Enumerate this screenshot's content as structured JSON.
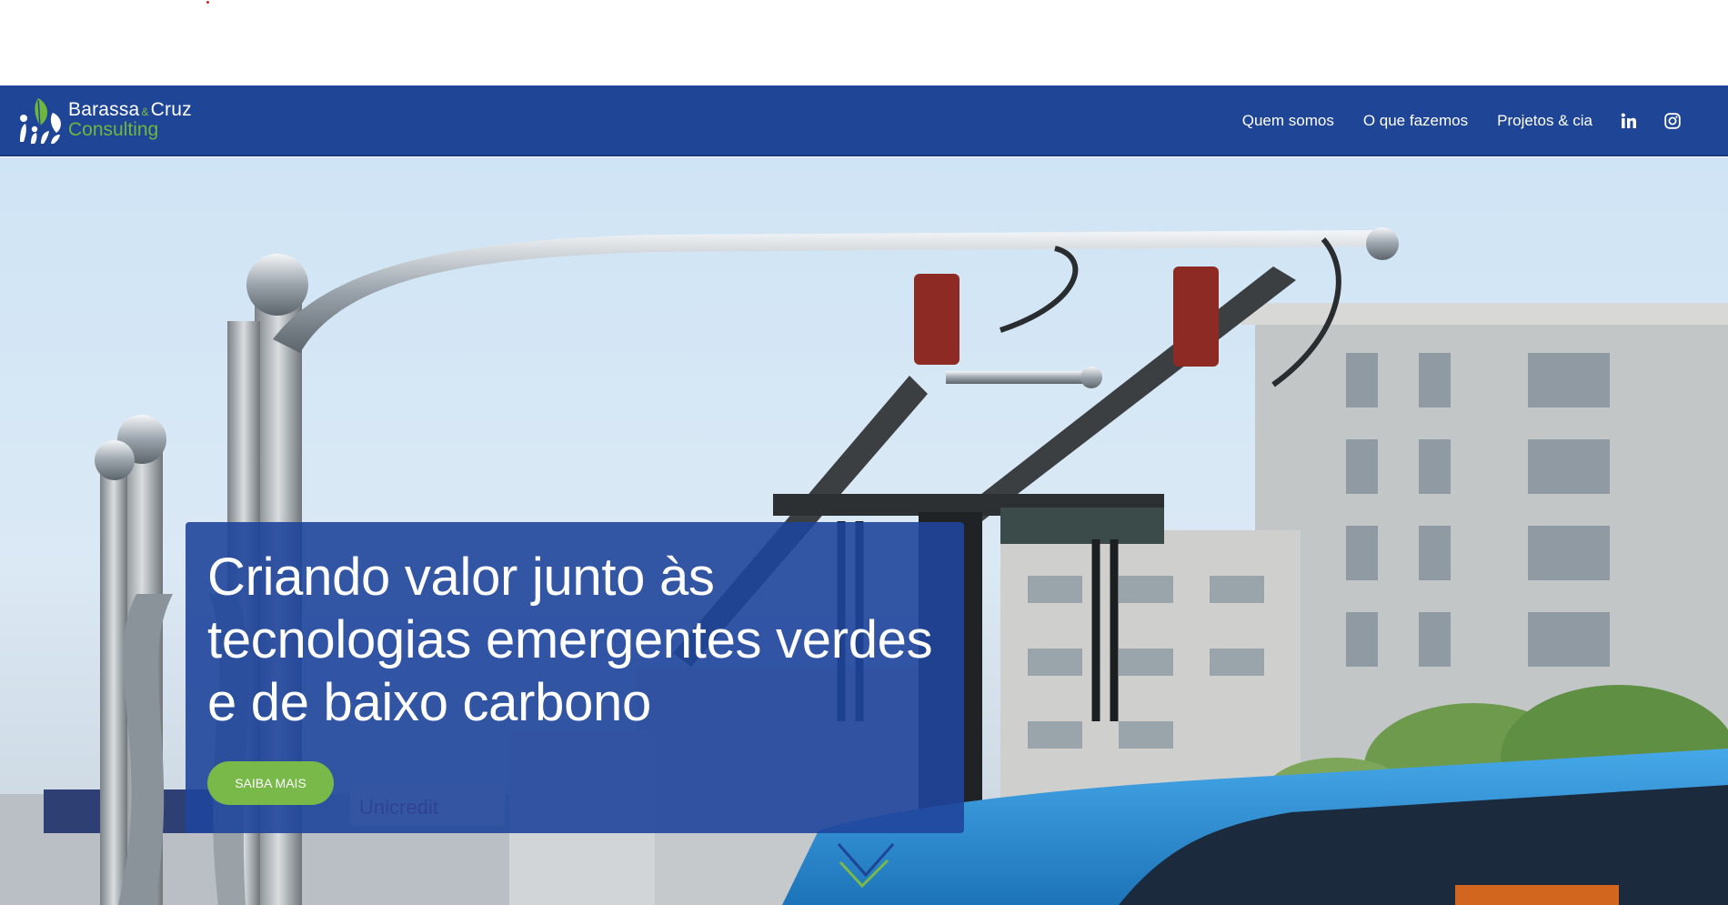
{
  "header": {
    "logo": {
      "name_first": "Barassa",
      "amp": "&",
      "name_second": "Cruz",
      "subtitle": "Consulting",
      "icon": "leaf-people-logo"
    },
    "nav": [
      {
        "label": "Quem somos"
      },
      {
        "label": "O que fazemos"
      },
      {
        "label": "Projetos & cia"
      }
    ],
    "social": [
      {
        "icon": "linkedin-icon"
      },
      {
        "icon": "instagram-icon"
      }
    ]
  },
  "hero": {
    "title": "Criando valor junto às tecnologias emergentes verdes e de baixo carbono",
    "cta_label": "SAIBA MAIS",
    "scroll_icon": "chevron-down-icon"
  },
  "colors": {
    "navbar": "#1f4596",
    "accent_green": "#78b94a",
    "hero_box": "#1f459b",
    "text_light": "#ffffff"
  }
}
